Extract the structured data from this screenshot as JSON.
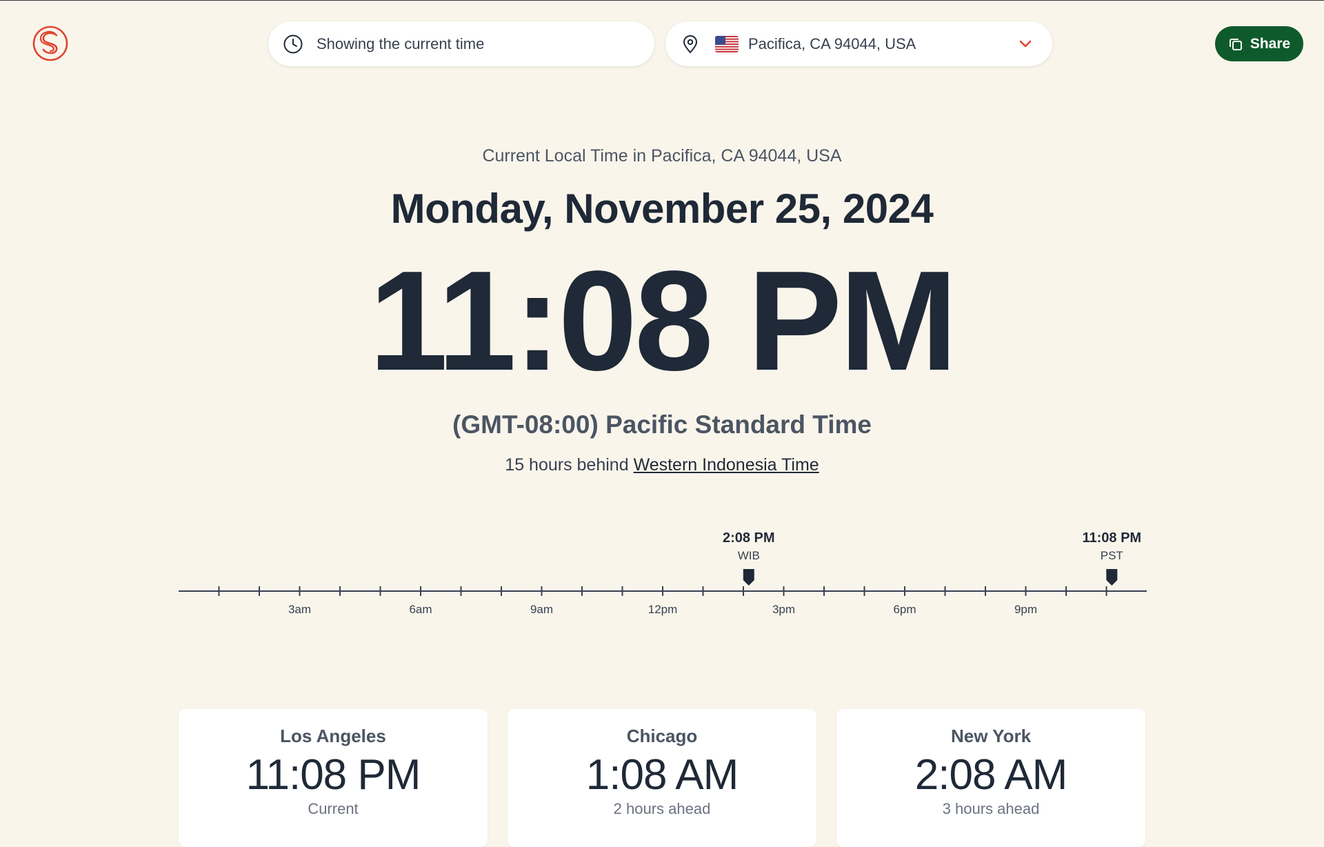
{
  "header": {
    "time_mode": "Showing the current time",
    "location": "Pacifica, CA 94044, USA",
    "share_label": "Share"
  },
  "main": {
    "subtitle": "Current Local Time in Pacifica, CA 94044, USA",
    "date": "Monday, November 25, 2024",
    "time": "11:08 PM",
    "timezone": "(GMT-08:00) Pacific Standard Time",
    "diff_prefix": "15 hours behind ",
    "diff_link": "Western Indonesia Time"
  },
  "timeline": {
    "hour_labels": [
      "3am",
      "6am",
      "9am",
      "12pm",
      "3pm",
      "6pm",
      "9pm"
    ],
    "markers": [
      {
        "time": "2:08 PM",
        "zone": "WIB",
        "hour": 14.133
      },
      {
        "time": "11:08 PM",
        "zone": "PST",
        "hour": 23.133
      }
    ]
  },
  "cards": [
    {
      "city": "Los Angeles",
      "time": "11:08 PM",
      "relation": "Current"
    },
    {
      "city": "Chicago",
      "time": "1:08 AM",
      "relation": "2 hours ahead"
    },
    {
      "city": "New York",
      "time": "2:08 AM",
      "relation": "3 hours ahead"
    }
  ],
  "colors": {
    "background": "#faf5eb",
    "share_button": "#0f5a2c",
    "accent_red": "#e0442e",
    "text_dark": "#1f2937"
  },
  "icons": {
    "logo": "logo-icon",
    "time_mode": "clock-icon",
    "location": "map-pin-icon",
    "flag": "us-flag-icon",
    "dropdown": "chevron-down-icon",
    "share": "copy-icon"
  }
}
